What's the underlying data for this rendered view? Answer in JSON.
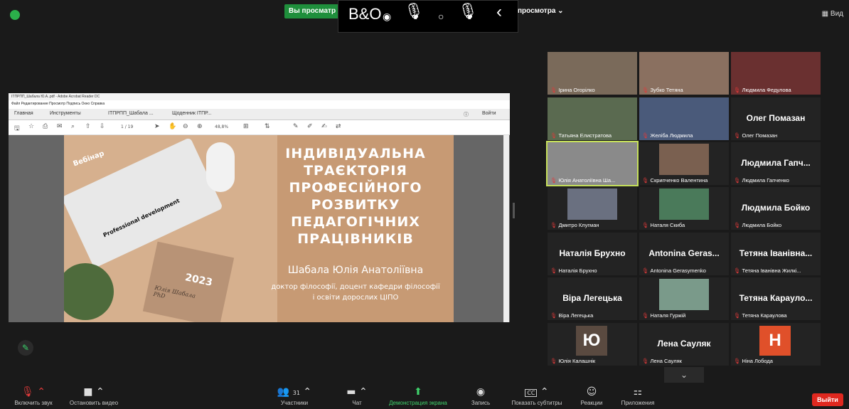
{
  "topbar": {
    "view_banner": "Вы просматр",
    "view_banner_tail": "просмотра",
    "bo_logo": "B&O",
    "view_label": "Вид"
  },
  "share": {
    "window_title": "ІТПРПП_Шабала Ю.А..pdf - Adobe Acrobat Reader DC",
    "menu": "Файл  Редактирование  Просмотр  Подпись  Окно  Справка",
    "tabs": [
      "Главная",
      "Инструменты",
      "ІТПРПП_Шабала ...",
      "Щоденник ІТПР..."
    ],
    "signin": "Войти",
    "page_indicator": "1 / 19",
    "zoom": "48,8%",
    "slide": {
      "title": "ІНДИВІДУАЛЬНА ТРАЄКТОРІЯ ПРОФЕСІЙНОГО РОЗВИТКУ ПЕДАГОГІЧНИХ ПРАЦІВНИКІВ",
      "author": "Шабала Юлія Анатоліївна",
      "desc": "доктор філософії, доцент кафедри філософії і освіти дорослих ЦІПО",
      "badge": "Вебінар",
      "notebook_tag": "Professional development",
      "year": "2023",
      "signature": "Юлія Шабала PhD"
    }
  },
  "tiles": [
    {
      "name": "Ірина Огорілко",
      "big": "",
      "avatar": "",
      "color": "#7a6a5a"
    },
    {
      "name": "Зубко Тетяна",
      "big": "",
      "avatar": "",
      "color": "#8a7060"
    },
    {
      "name": "Людмила Федулова",
      "big": "",
      "avatar": "",
      "color": "#6a3030"
    },
    {
      "name": "Татьяна Елистратова",
      "big": "",
      "avatar": "",
      "color": "#5a6a50"
    },
    {
      "name": "Желіба Людмила",
      "big": "",
      "avatar": "",
      "color": "#4a5a7a"
    },
    {
      "name": "Олег Помазан",
      "big": "Олег Помазан",
      "avatar": "",
      "color": ""
    },
    {
      "name": "Юлія Анатоліївна Ша...",
      "big": "",
      "avatar": "",
      "color": "#8a8a8a"
    },
    {
      "name": "Скрипченко Валентина",
      "big": "",
      "avatar": "",
      "color": "#7a6050"
    },
    {
      "name": "Людмила Гапченко",
      "big": "Людмила Гапч...",
      "avatar": "",
      "color": ""
    },
    {
      "name": "Дмитро Клугман",
      "big": "",
      "avatar": "",
      "color": "#6a7080"
    },
    {
      "name": "Наталя Скиба",
      "big": "",
      "avatar": "",
      "color": "#4a7a5a"
    },
    {
      "name": "Людмила Бойко",
      "big": "Людмила Бойко",
      "avatar": "",
      "color": ""
    },
    {
      "name": "Наталія Брухно",
      "big": "Наталія Брухно",
      "avatar": "",
      "color": ""
    },
    {
      "name": "Antonina Gerasymenko",
      "big": "Antonina Geras...",
      "avatar": "",
      "color": ""
    },
    {
      "name": "Тетяна Іванівна Жилкі...",
      "big": "Тетяна Іванівна...",
      "avatar": "",
      "color": ""
    },
    {
      "name": "Віра Легецька",
      "big": "Віра Легецька",
      "avatar": "",
      "color": ""
    },
    {
      "name": "Наталя Гуржій",
      "big": "",
      "avatar": "",
      "color": "#7a9a8a"
    },
    {
      "name": "Тетяна Караулова",
      "big": "Тетяна Карауло...",
      "avatar": "",
      "color": ""
    },
    {
      "name": "Юлія Калашнік",
      "big": "",
      "avatar": "Ю",
      "color": "#5a4a40"
    },
    {
      "name": "Лена Сауляк",
      "big": "Лена Сауляк",
      "avatar": "",
      "color": ""
    },
    {
      "name": "Ніна Лобода",
      "big": "",
      "avatar": "H",
      "color": "#e0502a"
    }
  ],
  "toolbar": {
    "mute": "Включить звук",
    "video": "Остановить видео",
    "participants": "Участники",
    "participants_count": "31",
    "chat": "Чат",
    "share": "Демонстрация экрана",
    "record": "Запись",
    "cc_label": "CC",
    "captions": "Показать субтитры",
    "reactions": "Реакции",
    "apps": "Приложения",
    "exit": "Выйти"
  },
  "colors": {
    "accent_green": "#3fd16b",
    "exit_red": "#e0281f",
    "highlight": "#c6e05a"
  }
}
